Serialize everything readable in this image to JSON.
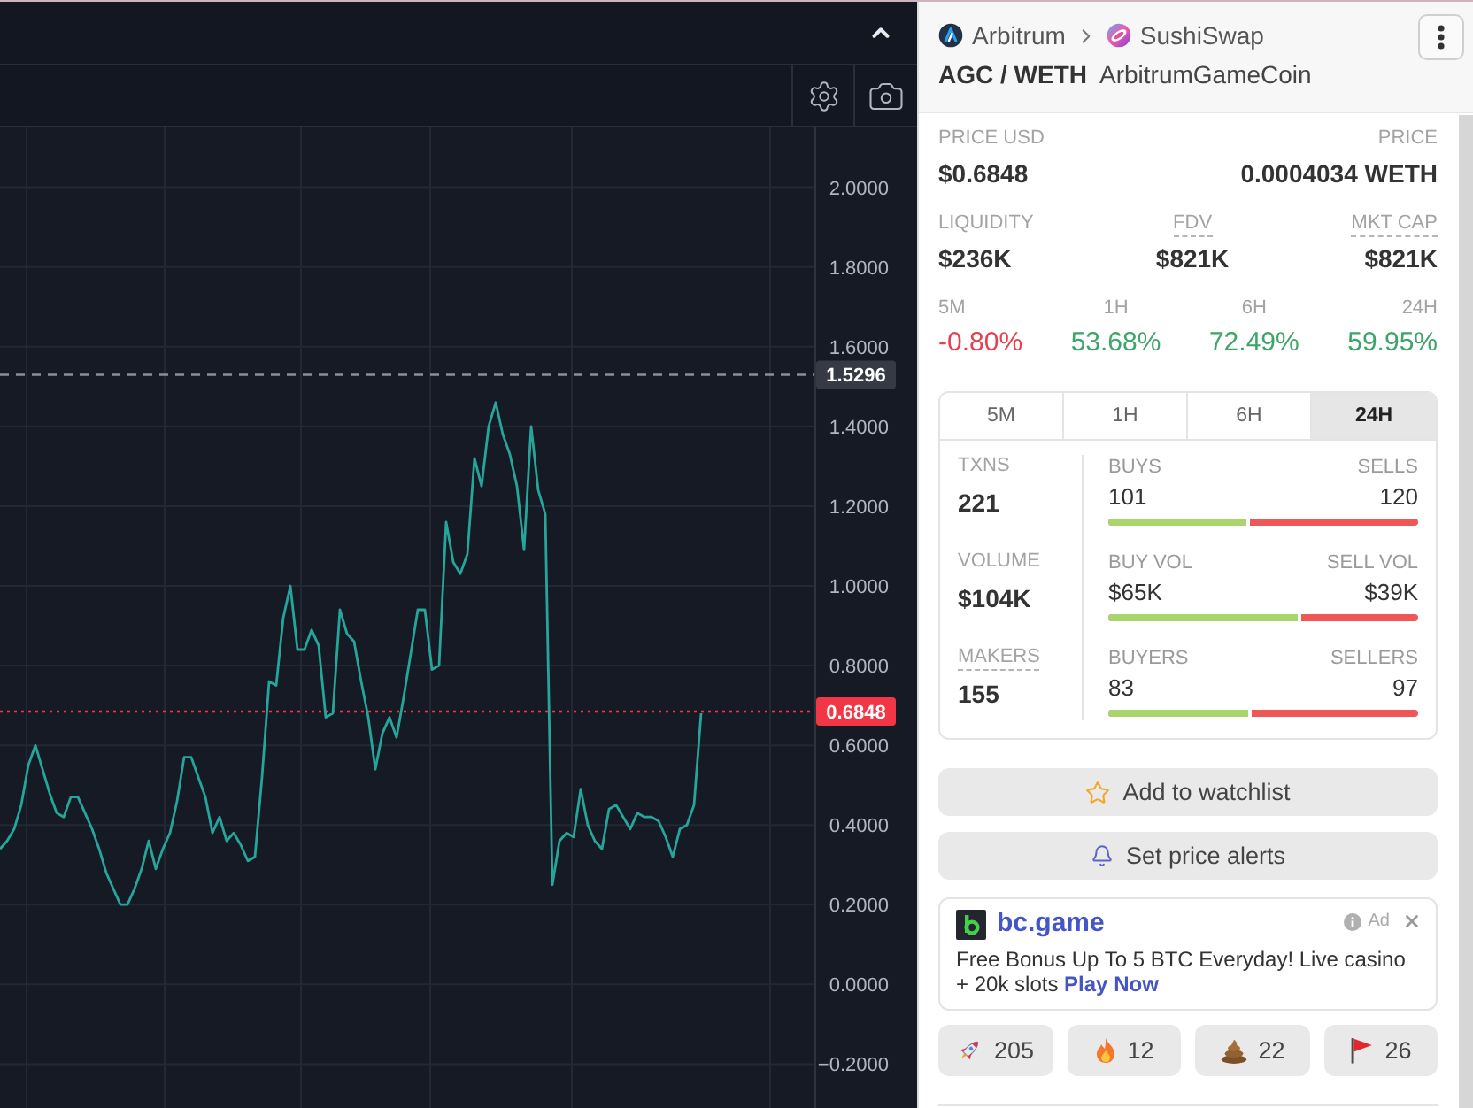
{
  "chart": {
    "chart_data": {
      "type": "line",
      "values": [
        0.34,
        0.36,
        0.39,
        0.45,
        0.55,
        0.6,
        0.54,
        0.48,
        0.43,
        0.42,
        0.47,
        0.47,
        0.43,
        0.39,
        0.34,
        0.28,
        0.24,
        0.2,
        0.2,
        0.24,
        0.29,
        0.36,
        0.29,
        0.34,
        0.38,
        0.46,
        0.57,
        0.57,
        0.52,
        0.47,
        0.38,
        0.42,
        0.36,
        0.38,
        0.35,
        0.31,
        0.32,
        0.52,
        0.76,
        0.75,
        0.92,
        1.0,
        0.84,
        0.84,
        0.89,
        0.85,
        0.67,
        0.68,
        0.94,
        0.88,
        0.86,
        0.76,
        0.67,
        0.54,
        0.63,
        0.67,
        0.62,
        0.72,
        0.83,
        0.94,
        0.94,
        0.79,
        0.8,
        1.16,
        1.06,
        1.03,
        1.08,
        1.32,
        1.25,
        1.4,
        1.46,
        1.38,
        1.33,
        1.25,
        1.09,
        1.4,
        1.24,
        1.18,
        0.25,
        0.36,
        0.38,
        0.37,
        0.49,
        0.4,
        0.36,
        0.34,
        0.44,
        0.45,
        0.42,
        0.39,
        0.43,
        0.42,
        0.42,
        0.41,
        0.37,
        0.32,
        0.39,
        0.4,
        0.45,
        0.68
      ],
      "ylim": [
        -0.31,
        2.15
      ],
      "yticks": [
        {
          "value": 2,
          "label": "2.0000"
        },
        {
          "value": 1.8,
          "label": "1.8000"
        },
        {
          "value": 1.6,
          "label": "1.6000"
        },
        {
          "value": 1.4,
          "label": "1.4000"
        },
        {
          "value": 1.2,
          "label": "1.2000"
        },
        {
          "value": 1,
          "label": "1.0000"
        },
        {
          "value": 0.8,
          "label": "0.8000"
        },
        {
          "value": 0.6,
          "label": "0.6000"
        },
        {
          "value": 0.4,
          "label": "0.4000"
        },
        {
          "value": 0.2,
          "label": "0.2000"
        },
        {
          "value": 0,
          "label": "0.0000"
        },
        {
          "value": -0.2,
          "label": "−0.2000"
        }
      ],
      "grid": true,
      "ref_lines": [
        {
          "axis": "y",
          "value": 1.5296,
          "label": "1.5296",
          "color": "#8a8e99"
        },
        {
          "axis": "y",
          "value": 0.6848,
          "label": "0.6848",
          "color": "#f23645"
        }
      ]
    }
  },
  "pair_header": {
    "breadcrumb": [
      {
        "kind": "chain",
        "label": "Arbitrum"
      },
      {
        "kind": "dex",
        "label": "SushiSwap"
      }
    ],
    "pair": "AGC / WETH",
    "token_name": "ArbitrumGameCoin"
  },
  "price_stats": [
    {
      "label": "PRICE USD",
      "value": "$0.6848",
      "dotted_underline": false
    },
    {
      "label": "PRICE",
      "value": "0.0004034 WETH",
      "dotted_underline": false
    }
  ],
  "market_stats": [
    {
      "label": "LIQUIDITY",
      "value": "$236K",
      "dotted_underline": false
    },
    {
      "label": "FDV",
      "value": "$821K",
      "dotted_underline": true
    },
    {
      "label": "MKT CAP",
      "value": "$821K",
      "dotted_underline": true
    }
  ],
  "price_changes": [
    {
      "label": "5M",
      "value": "-0.80%",
      "color": "#e5404f"
    },
    {
      "label": "1H",
      "value": "53.68%",
      "color": "#3ea46a"
    },
    {
      "label": "6H",
      "value": "72.49%",
      "color": "#3ea46a"
    },
    {
      "label": "24H",
      "value": "59.95%",
      "color": "#3ea46a"
    }
  ],
  "period_tabs": [
    {
      "label": "5M",
      "selected": false
    },
    {
      "label": "1H",
      "selected": false
    },
    {
      "label": "6H",
      "selected": false
    },
    {
      "label": "24H",
      "selected": true
    }
  ],
  "activity": {
    "totals": [
      {
        "label": "TXNS",
        "value": "221",
        "dotted_underline": false
      },
      {
        "label": "VOLUME",
        "value": "$104K",
        "dotted_underline": false
      },
      {
        "label": "MAKERS",
        "value": "155",
        "dotted_underline": true
      }
    ],
    "splits": [
      {
        "left_label": "BUYS",
        "left_value": "101",
        "right_label": "SELLS",
        "right_value": "120",
        "level": 0.457
      },
      {
        "left_label": "BUY VOL",
        "left_value": "$65K",
        "right_label": "SELL VOL",
        "right_value": "$39K",
        "level": 0.625
      },
      {
        "left_label": "BUYERS",
        "left_value": "83",
        "right_label": "SELLERS",
        "right_value": "97",
        "level": 0.461
      }
    ]
  },
  "actions": [
    {
      "kind": "watchlist",
      "label": "Add to watchlist"
    },
    {
      "kind": "alerts",
      "label": "Set price alerts"
    }
  ],
  "ad": {
    "brand": "bc.game",
    "badge": "Ad",
    "text": "Free Bonus Up To 5 BTC Everyday! Live casino + 20k slots",
    "link": "Play Now"
  },
  "reactions": [
    {
      "kind": "rocket",
      "count": "205"
    },
    {
      "kind": "fire",
      "count": "12"
    },
    {
      "kind": "poop",
      "count": "22"
    },
    {
      "kind": "flag",
      "count": "26"
    }
  ]
}
